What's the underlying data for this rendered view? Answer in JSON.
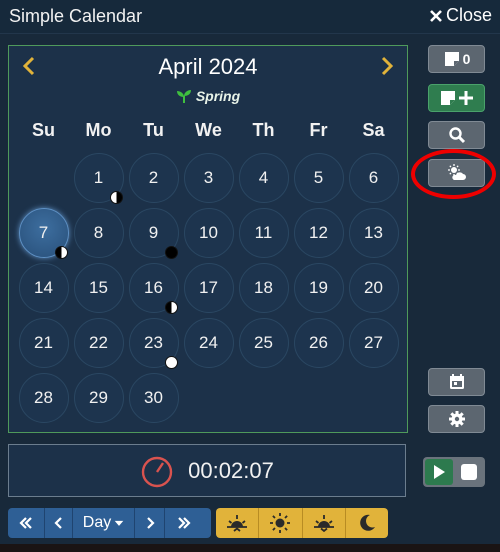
{
  "window": {
    "title": "Simple Calendar",
    "close_label": "Close"
  },
  "calendar": {
    "month_year": "April 2024",
    "season": "Spring",
    "weekdays": [
      "Su",
      "Mo",
      "Tu",
      "We",
      "Th",
      "Fr",
      "Sa"
    ],
    "first_weekday_index": 1,
    "days_in_month": 30,
    "today": 7,
    "moon_phases": {
      "1": "last",
      "7": "first",
      "9": "new",
      "16": "first",
      "23": "full"
    }
  },
  "sidebar": {
    "notes_count": "0"
  },
  "clock": {
    "time": "00:02:07"
  },
  "time_nav": {
    "unit_label": "Day"
  },
  "colors": {
    "accent_green": "#2f7d4f",
    "accent_blue": "#2e5f95",
    "accent_yellow": "#e1b33a",
    "highlight_red": "#e00000"
  }
}
